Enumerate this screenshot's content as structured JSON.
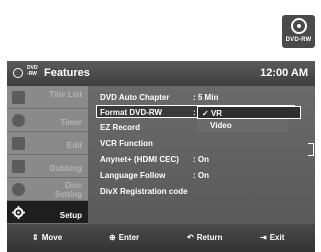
{
  "badge": {
    "label": "DVD-RW"
  },
  "header": {
    "disc_type_top": "DVD",
    "disc_type_bottom": "-RW",
    "title": "Features",
    "clock": "12:00 AM"
  },
  "sidebar": {
    "items": [
      {
        "label": "Title List",
        "icon": "title-list-icon"
      },
      {
        "label": "Timer",
        "icon": "timer-icon"
      },
      {
        "label": "Edit",
        "icon": "edit-icon"
      },
      {
        "label": "Dubbing",
        "icon": "dubbing-icon"
      },
      {
        "label": "Disc Setting",
        "label_line1": "Disc",
        "label_line2": "Setting",
        "icon": "disc-setting-icon"
      },
      {
        "label": "Setup",
        "icon": "setup-gear-icon",
        "active": true
      }
    ]
  },
  "settings": [
    {
      "label": "DVD Auto Chapter",
      "value": ": 5 Min"
    },
    {
      "label": "Format DVD-RW",
      "value": ":"
    },
    {
      "label": "EZ Record",
      "value": ""
    },
    {
      "label": "VCR Function",
      "value": ""
    },
    {
      "label": "Anynet+ (HDMI CEC)",
      "value": ": On"
    },
    {
      "label": "Language Follow",
      "value": ": On"
    },
    {
      "label": "DivX Registration code",
      "value": ""
    }
  ],
  "dropdown": {
    "options": [
      {
        "label": "VR",
        "check": "✓",
        "selected": true
      },
      {
        "label": "Video",
        "selected": false
      }
    ]
  },
  "footer": {
    "move": "Move",
    "move_glyph": "⇕",
    "enter": "Enter",
    "enter_glyph": "⊕",
    "return": "Return",
    "return_glyph": "↶",
    "exit": "Exit",
    "exit_glyph": "⇥"
  },
  "colors": {
    "header_bg": "#4a4a4a",
    "panel_bg": "#6a6a6a",
    "sidebar_bg": "#8a8a8a",
    "active_bg": "#1e1e1e",
    "text": "#ffffff"
  }
}
